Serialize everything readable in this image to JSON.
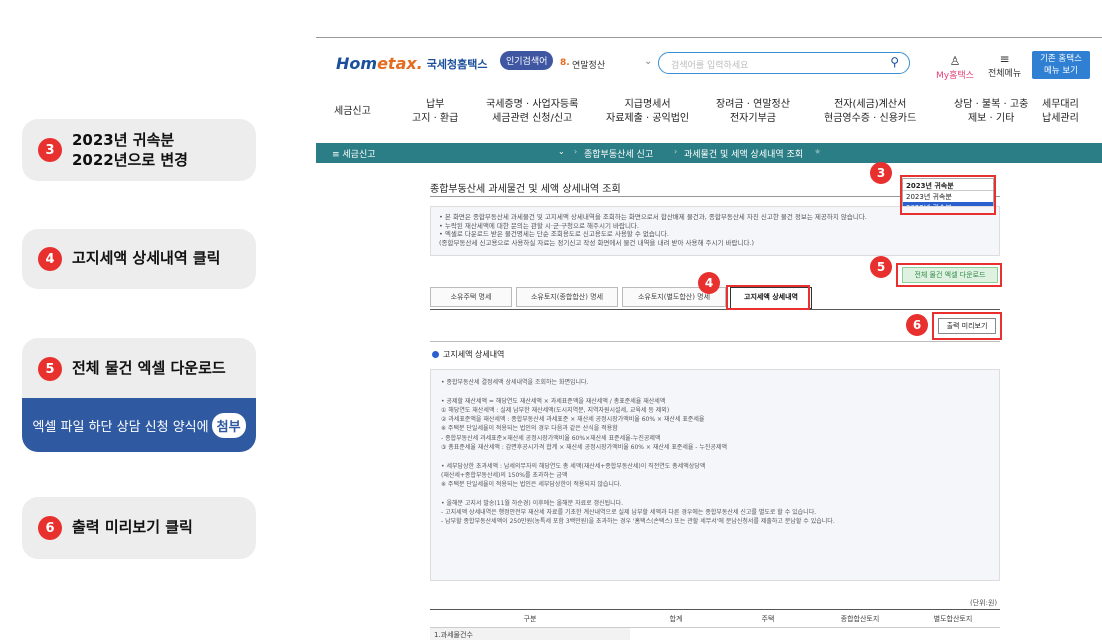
{
  "guide": {
    "steps": [
      {
        "num": "3",
        "line1": "2023년 귀속분",
        "line2": "2022년으로 변경"
      },
      {
        "num": "4",
        "line1": "고지세액 상세내역 클릭",
        "line2": ""
      },
      {
        "num": "5",
        "line1": "전체 물건 엑셀 다운로드",
        "line2": ""
      },
      {
        "num": "6",
        "line1": "출력 미리보기 클릭",
        "line2": ""
      }
    ],
    "note_text": "엑셀 파일 하단 상담 신청 양식에",
    "note_pill": "첨부"
  },
  "header": {
    "logo_main": "Hom",
    "logo_tax": "etax.",
    "logo_name": "국세청홈택스",
    "popular_badge": "인기검색어",
    "popular_num": "8.",
    "popular_word": "연말정산",
    "search_placeholder": "검색어를 입력하세요",
    "my_label": "My홈택스",
    "menu_label": "전체메뉴",
    "old_menu_line1": "기존 홈택스",
    "old_menu_line2": "메뉴 보기"
  },
  "gnb": [
    {
      "l1": "세금신고",
      "l2": ""
    },
    {
      "l1": "납부",
      "l2": "고지 · 환급"
    },
    {
      "l1": "국세증명 · 사업자등록",
      "l2": "세금관련 신청/신고"
    },
    {
      "l1": "지급명세서",
      "l2": "자료제출 · 공익법인"
    },
    {
      "l1": "장려금 · 연말정산",
      "l2": "전자기부금"
    },
    {
      "l1": "전자(세금)계산서",
      "l2": "현금영수증 · 신용카드"
    },
    {
      "l1": "상담 · 불복 · 고충",
      "l2": "제보 · 기타"
    },
    {
      "l1": "세무대리",
      "l2": "납세관리"
    }
  ],
  "navbar": {
    "menu": "≡  세금신고",
    "crumb1": "종합부동산세 신고",
    "crumb2": "과세물건 및 세액 상세내역 조회"
  },
  "page": {
    "title": "종합부동산세 과세물건 및 세액 상세내역 조회",
    "year_current": "2023년 귀속분",
    "year_options": [
      "2023년 귀속분",
      "2022년 귀속분"
    ],
    "info_lines": [
      "• 본 화면은 종합부동산세 과세물건 및 고지세액 상세내역을 조회하는 화면으로서 합산배제 물건과, 종합부동산세 자진 신고한 물건 정보는 제공하지 않습니다.",
      "• 누락된 재산세액에 대한 문의는 관할 시·군·구청으로 해주시기 바랍니다.",
      "• 엑셀로 다운로드 받은 물건명세는 단순 조회용도로 신고용도로 사용할 수 없습니다.",
      "  (종합부동산세 신고용으로 사용하실 자료는 정기신고 작성 화면에서 물건 내역을 내려 받아 사용해 주시기 바랍니다.)"
    ],
    "excel_button": "전체 물건 엑셀 다운로드",
    "tabs": [
      "소유주택 명세",
      "소유토지(종합합산) 명세",
      "소유토지(별도합산) 명세",
      "고지세액 상세내역"
    ],
    "print_button": "출력 미리보기",
    "section_title": "고지세액 상세내역",
    "detail_lines": [
      "• 종합부동산세 결정세액 상세내역을 조회하는 화면입니다.",
      "",
      "• 공제할 재산세액 = 해당연도 재산세액 × 과세표준액을 재산세액 / 총표준세율 재산세액",
      "   ① 해당연도 재산세액 : 실제 납부한 재산세액(도시지역분, 지역자원시설세, 교육세 등 제외)",
      "   ② 과세표준액을 재산세액 : 종합부동산세 과세표준 × 재산세 공정시장가액비율 60% × 재산세 표준세율",
      "      ※ 주택분 단일세율이 적용되는 법인의 경우 다음과 같은 산식을 적용함",
      "        - 종합부동산세 과세표준×재산세 공정시장가액비율 60%×재산세 표준세율-누진공제액",
      "   ③ 총표준세율 재산세액 : 감면후공시가격 합계 × 재산세 공정시장가액비율 60% × 재산세 표준세율 - 누진공제액",
      "",
      "• 세부담상한 초과세액 : 납세의무자의 해당연도 총 세액(재산세+종합부동산세)이 직전연도 총세액상당액",
      "                              (재산세+종합부동산세)의 150%를 초과하는 금액",
      "   ※ 주택분 단일세율이 적용되는 법인은 세부담상한이 적용되지 않습니다.",
      "",
      "• 올해분 고지서 발송(11월 하순경) 이후에는 올해분 자료로 갱신됩니다.",
      "   - 고지세액 상세내역은 행정안전부 재산세 자료를 기초한 계산내역으로 실제 납부할 세액과 다른 경우에는 종합부동산세 신고를 별도로 할 수 있습니다.",
      "   - 납부할 종합부동산세액이 250만원(농특세 포함 3백만원)을 초과하는 경우 '홈택스(손택스) 또는 관할 세무서'에 분납신청서를 제출하고 분납할 수 있습니다."
    ],
    "unit": "(단위:원)",
    "table_headers": [
      "구분",
      "합계",
      "주택",
      "종합합산토지",
      "별도합산토지"
    ],
    "table_first_cell": "1.과세물건수"
  },
  "annotations": {
    "n3": "3",
    "n4": "4",
    "n5": "5",
    "n6": "6"
  },
  "colors": {
    "accent_red": "#e8312f",
    "nav_teal": "#2b7e85",
    "note_blue": "#2f5aa1"
  }
}
